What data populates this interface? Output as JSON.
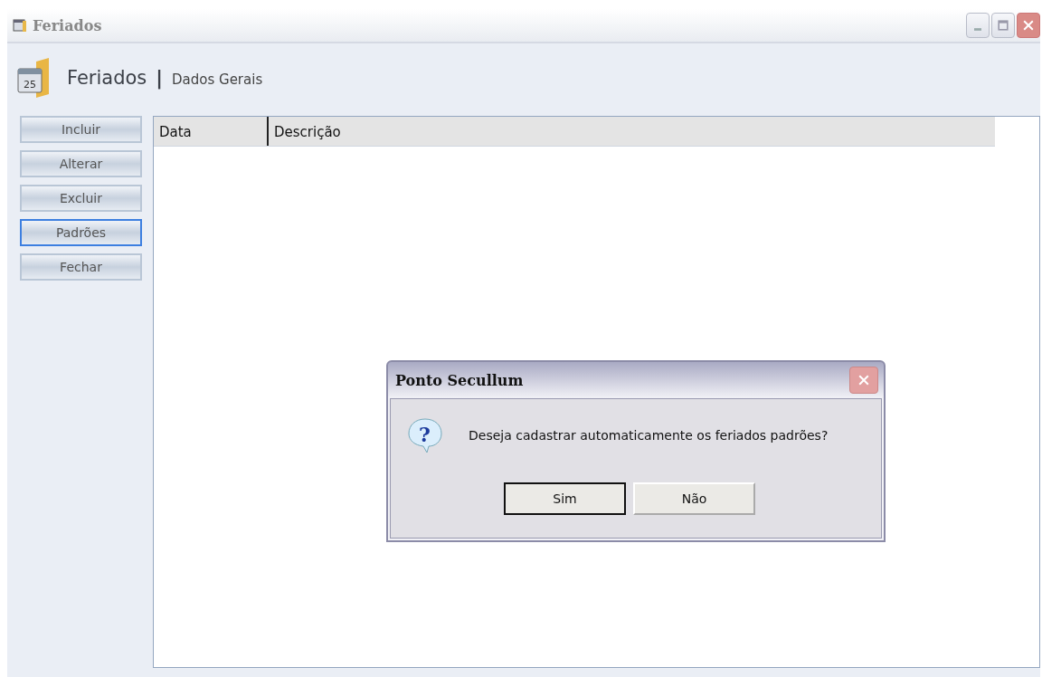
{
  "window": {
    "title": "Feriados"
  },
  "header": {
    "icon_day": "25",
    "title": "Feriados",
    "separator": "|",
    "subtitle": "Dados Gerais"
  },
  "actions": [
    {
      "label": "Incluir",
      "focused": false
    },
    {
      "label": "Alterar",
      "focused": false
    },
    {
      "label": "Excluir",
      "focused": false
    },
    {
      "label": "Padrões",
      "focused": true
    },
    {
      "label": "Fechar",
      "focused": false
    }
  ],
  "table": {
    "columns": [
      "Data",
      "Descrição"
    ]
  },
  "dialog": {
    "icon_glyph": "?",
    "title": "Ponto Secullum",
    "message": "Deseja cadastrar automaticamente os feriados padrões?",
    "buttons": [
      {
        "label": "Sim",
        "focused": true
      },
      {
        "label": "Não",
        "focused": false
      }
    ]
  }
}
